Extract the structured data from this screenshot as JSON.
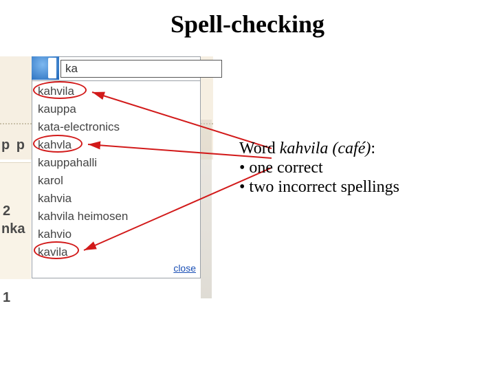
{
  "title": "Spell-checking",
  "search": {
    "value": "ka"
  },
  "suggestions": [
    "kahvila",
    "kauppa",
    "kata-electronics",
    "kahvla",
    "kauppahalli",
    "karol",
    "kahvia",
    "kahvila heimosen",
    "kahvio",
    "kavila"
  ],
  "close_label": "close",
  "bg_fragments": {
    "pp": "p p",
    "two": "2",
    "nka": "nka",
    "one": "1"
  },
  "annotation": {
    "line1_pre": "Word ",
    "line1_word": "kahvila",
    "line1_gloss": " (café)",
    "line1_post": ":",
    "bullet1": "• one correct",
    "bullet2": "• two incorrect spellings"
  }
}
